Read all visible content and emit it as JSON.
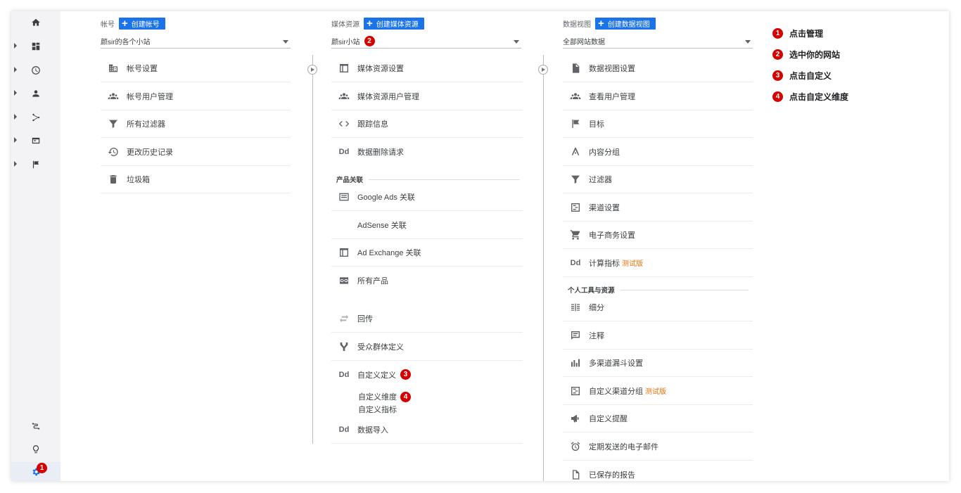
{
  "account": {
    "header_label": "帐号",
    "create_label": "创建帐号",
    "selected": "颜sir的各个小站",
    "items": [
      {
        "label": "帐号设置",
        "icon": "building-icon"
      },
      {
        "label": "帐号用户管理",
        "icon": "people-icon"
      },
      {
        "label": "所有过滤器",
        "icon": "filter-icon"
      },
      {
        "label": "更改历史记录",
        "icon": "history-icon"
      },
      {
        "label": "垃圾箱",
        "icon": "trash-icon"
      }
    ]
  },
  "property": {
    "header_label": "媒体资源",
    "create_label": "创建媒体资源",
    "selected": "颜sir小站",
    "selected_badge": "2",
    "items": [
      {
        "label": "媒体资源设置",
        "icon": "window-icon"
      },
      {
        "label": "媒体资源用户管理",
        "icon": "people-icon"
      },
      {
        "label": "跟踪信息",
        "icon": "code-icon"
      },
      {
        "label": "数据删除请求",
        "icon": "dd-icon",
        "glyph": "Dd"
      }
    ],
    "product_linking_title": "产品关联",
    "product_items": [
      {
        "label": "Google Ads 关联",
        "icon": "ads-icon"
      },
      {
        "label": "AdSense 关联",
        "icon": "none"
      },
      {
        "label": "Ad Exchange 关联",
        "icon": "window-icon"
      },
      {
        "label": "所有产品",
        "icon": "link-icon"
      }
    ],
    "more_items": [
      {
        "label": "回传",
        "icon": "postback-icon"
      },
      {
        "label": "受众群体定义",
        "icon": "audience-icon"
      },
      {
        "label": "自定义定义",
        "icon": "dd-icon",
        "glyph": "Dd",
        "badge": "3"
      }
    ],
    "custom_sub": [
      {
        "label": "自定义维度",
        "badge": "4"
      },
      {
        "label": "自定义指标"
      }
    ],
    "import_item": {
      "label": "数据导入",
      "icon": "dd-icon",
      "glyph": "Dd"
    }
  },
  "view": {
    "header_label": "数据视图",
    "create_label": "创建数据视图",
    "selected": "全部网站数据",
    "items": [
      {
        "label": "数据视图设置",
        "icon": "document-icon"
      },
      {
        "label": "查看用户管理",
        "icon": "people-icon"
      },
      {
        "label": "目标",
        "icon": "flag-icon"
      },
      {
        "label": "内容分组",
        "icon": "grouping-icon"
      },
      {
        "label": "过滤器",
        "icon": "filter-icon"
      },
      {
        "label": "渠道设置",
        "icon": "channel-icon"
      },
      {
        "label": "电子商务设置",
        "icon": "cart-icon"
      },
      {
        "label": "计算指标",
        "icon": "dd-icon",
        "glyph": "Dd",
        "beta": "测试版"
      }
    ],
    "personal_title": "个人工具与资源",
    "personal_items": [
      {
        "label": "细分",
        "icon": "segments-icon"
      },
      {
        "label": "注释",
        "icon": "comment-icon"
      },
      {
        "label": "多渠道漏斗设置",
        "icon": "bar-chart-icon"
      },
      {
        "label": "自定义渠道分组",
        "icon": "channel-icon",
        "beta": "测试版"
      },
      {
        "label": "自定义提醒",
        "icon": "megaphone-icon"
      },
      {
        "label": "定期发送的电子邮件",
        "icon": "alarm-icon"
      },
      {
        "label": "已保存的报告",
        "icon": "report-icon"
      }
    ]
  },
  "rail": {
    "icons": [
      "home-icon",
      "customization-icon",
      "realtime-icon",
      "audience-icon",
      "acquisition-icon",
      "behavior-icon",
      "conversions-icon"
    ],
    "bottom_icons": [
      "attribution-icon",
      "discover-icon",
      "admin-gear-icon"
    ],
    "admin_badge": "1"
  },
  "legend": [
    {
      "num": "1",
      "text": "点击管理"
    },
    {
      "num": "2",
      "text": "选中你的网站"
    },
    {
      "num": "3",
      "text": "点击自定义"
    },
    {
      "num": "4",
      "text": "点击自定义维度"
    }
  ],
  "colors": {
    "accent": "#1a73e8",
    "badge": "#d50000",
    "beta": "#e8710a"
  }
}
